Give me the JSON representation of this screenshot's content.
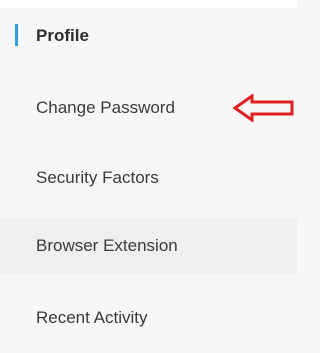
{
  "menu": {
    "active_item": "Profile",
    "items": [
      {
        "label": "Change Password"
      },
      {
        "label": "Security Factors"
      },
      {
        "label": "Browser Extension"
      },
      {
        "label": "Recent Activity"
      }
    ]
  },
  "colors": {
    "active_indicator": "#2f9fd8",
    "annotation_arrow": "#e0201f",
    "hover_background": "#efefef"
  },
  "icons": {
    "annotation": "left-arrow-icon"
  }
}
